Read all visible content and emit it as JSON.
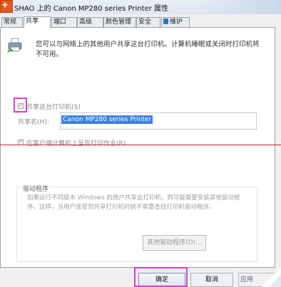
{
  "window": {
    "title": "SHAO 上的 Canon MP280 series Printer 属性"
  },
  "tabs": [
    {
      "label": "常规",
      "active": false
    },
    {
      "label": "共享",
      "active": true
    },
    {
      "label": "端口",
      "active": false
    },
    {
      "label": "高级",
      "active": false
    },
    {
      "label": "颜色管理",
      "active": false
    },
    {
      "label": "安全",
      "active": false
    },
    {
      "label": "维护",
      "active": false
    }
  ],
  "sharing": {
    "description": "您可以与网络上的其他用户共享这台打印机。计算机睡眠或关闭时打印机将不可用。",
    "share_checkbox_label": "共享这台打印机(S)",
    "share_checked": true,
    "share_name_label": "共享名(H):",
    "share_name_value": "Canon MP280 series Printer",
    "render_checkbox_label": "在客户端计算机上呈现打印作业(R)",
    "render_checked": true
  },
  "drivers": {
    "group_label": "驱动程序",
    "text": "如果运行不同版本 Windows 的用户共享此打印机，则可能需要安装其他驱动程序。这样，当用户连接到共享打印机时就不需要查找打印机驱动程序。",
    "button_label": "其他驱动程序(D)..."
  },
  "buttons": {
    "ok": "确定",
    "cancel": "取消",
    "apply": "应用"
  },
  "icons": {
    "app": "app-icon",
    "printer": "printer-icon",
    "maintenance": "maintenance-tab-icon"
  },
  "colors": {
    "highlight": "#d43fd6",
    "selection": "#3a82e0",
    "red_line": "#c0262b"
  }
}
